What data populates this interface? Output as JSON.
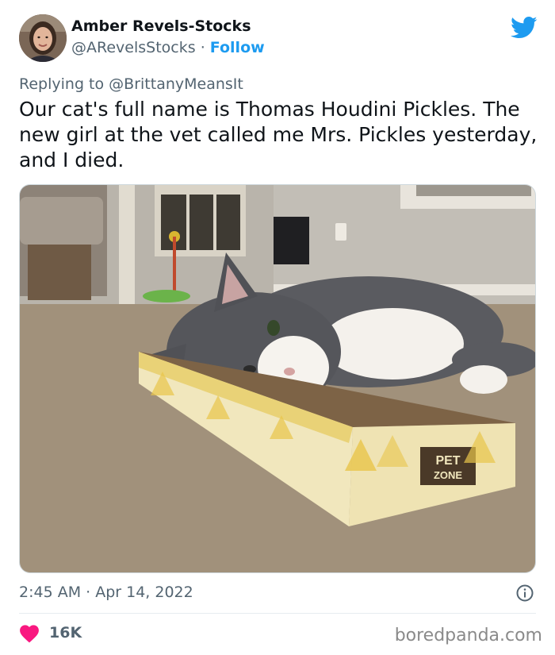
{
  "author": {
    "name": "Amber Revels-Stocks",
    "handle": "@ARevelsStocks",
    "separator": "·",
    "follow_label": "Follow"
  },
  "reply": {
    "prefix": "Replying to",
    "mention": "@BrittanyMeansIt"
  },
  "tweet": {
    "text": "Our cat's full name is Thomas Houdini Pickles. The new girl at the vet called me Mrs. Pickles yesterday, and I died."
  },
  "photo": {
    "box_brand_line1": "PET",
    "box_brand_line2": "ZONE"
  },
  "footer": {
    "timestamp": "2:45 AM · Apr 14, 2022",
    "likes": "16K"
  },
  "watermark": "boredpanda.com",
  "colors": {
    "twitter_blue": "#1d9bf0",
    "like_red": "#f91880",
    "secondary_text": "#536471"
  },
  "icons": {
    "brand": "twitter-bird-icon",
    "info": "info-icon",
    "like": "heart-icon"
  }
}
